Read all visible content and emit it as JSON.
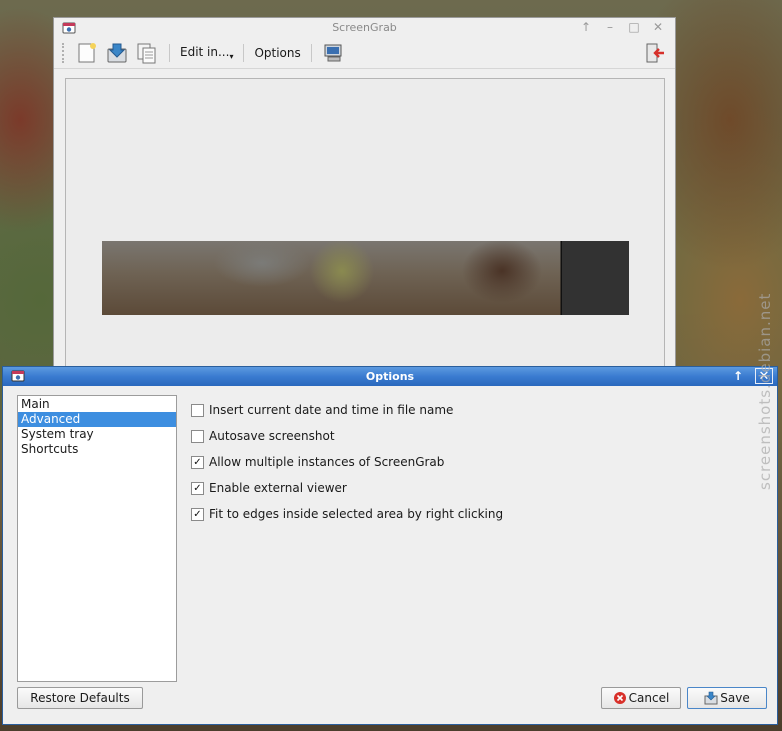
{
  "main_window": {
    "title": "ScreenGrab",
    "toolbar": {
      "edit_in_label": "Edit in...",
      "options_label": "Options"
    },
    "controls": {
      "up": "↑",
      "minimize": "–",
      "maximize": "□",
      "close": "✕"
    }
  },
  "dialog": {
    "title": "Options",
    "controls": {
      "up": "↑",
      "close": "✕"
    },
    "categories": [
      "Main",
      "Advanced",
      "System tray",
      "Shortcuts"
    ],
    "selected_category": "Advanced",
    "options": [
      {
        "label": "Insert current date and time in file name",
        "checked": false
      },
      {
        "label": "Autosave screenshot",
        "checked": false
      },
      {
        "label": "Allow multiple instances of ScreenGrab",
        "checked": true
      },
      {
        "label": "Enable external viewer",
        "checked": true
      },
      {
        "label": "Fit to edges inside selected area by right clicking",
        "checked": true
      }
    ],
    "buttons": {
      "restore_defaults": "Restore Defaults",
      "cancel": "Cancel",
      "save": "Save"
    }
  },
  "watermark": "screenshots.debian.net",
  "colors": {
    "dialog_title": "#3a7bd0",
    "selection": "#3d8ee0",
    "window_bg": "#efefef"
  },
  "icons": {
    "new": "new-screenshot-icon",
    "save": "save-icon",
    "copy": "copy-icon",
    "area": "capture-area-icon",
    "exit": "exit-icon",
    "cancel": "cancel-icon",
    "save_button": "save-disk-icon"
  }
}
